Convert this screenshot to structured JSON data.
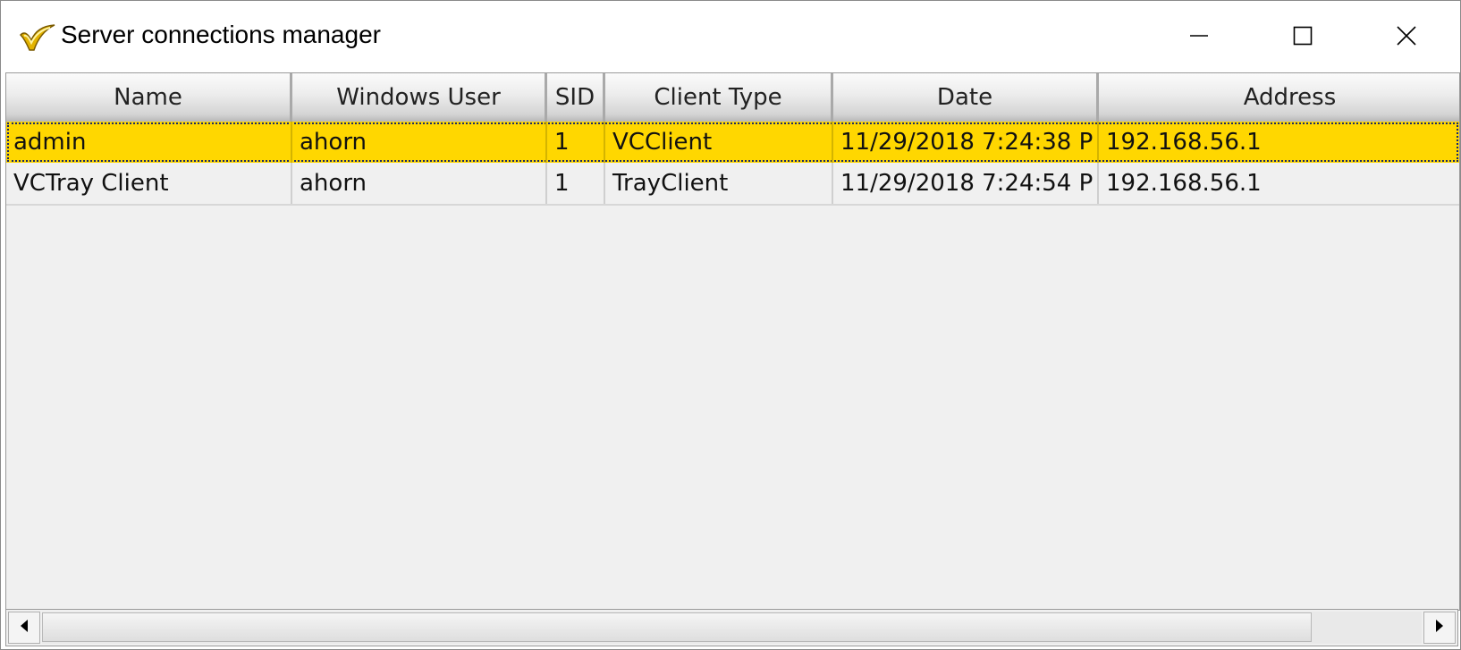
{
  "window": {
    "title": "Server connections manager"
  },
  "columns": [
    "Name",
    "Windows User",
    "SID",
    "Client Type",
    "Date",
    "Address"
  ],
  "rows": [
    {
      "name": "admin",
      "windows_user": "ahorn",
      "sid": "1",
      "client_type": "VCClient",
      "date": "11/29/2018 7:24:38 P",
      "address": "192.168.56.1"
    },
    {
      "name": "VCTray Client",
      "windows_user": "ahorn",
      "sid": "1",
      "client_type": "TrayClient",
      "date": "11/29/2018 7:24:54 P",
      "address": "192.168.56.1"
    }
  ],
  "selected_row": 0,
  "colors": {
    "selection": "#ffd700",
    "grid_background": "#f0f0f0"
  },
  "icons": {
    "app": "checkmark-v-icon",
    "minimize": "minimize-icon",
    "maximize": "maximize-icon",
    "close": "close-icon",
    "scroll_left": "arrow-left-icon",
    "scroll_right": "arrow-right-icon"
  }
}
